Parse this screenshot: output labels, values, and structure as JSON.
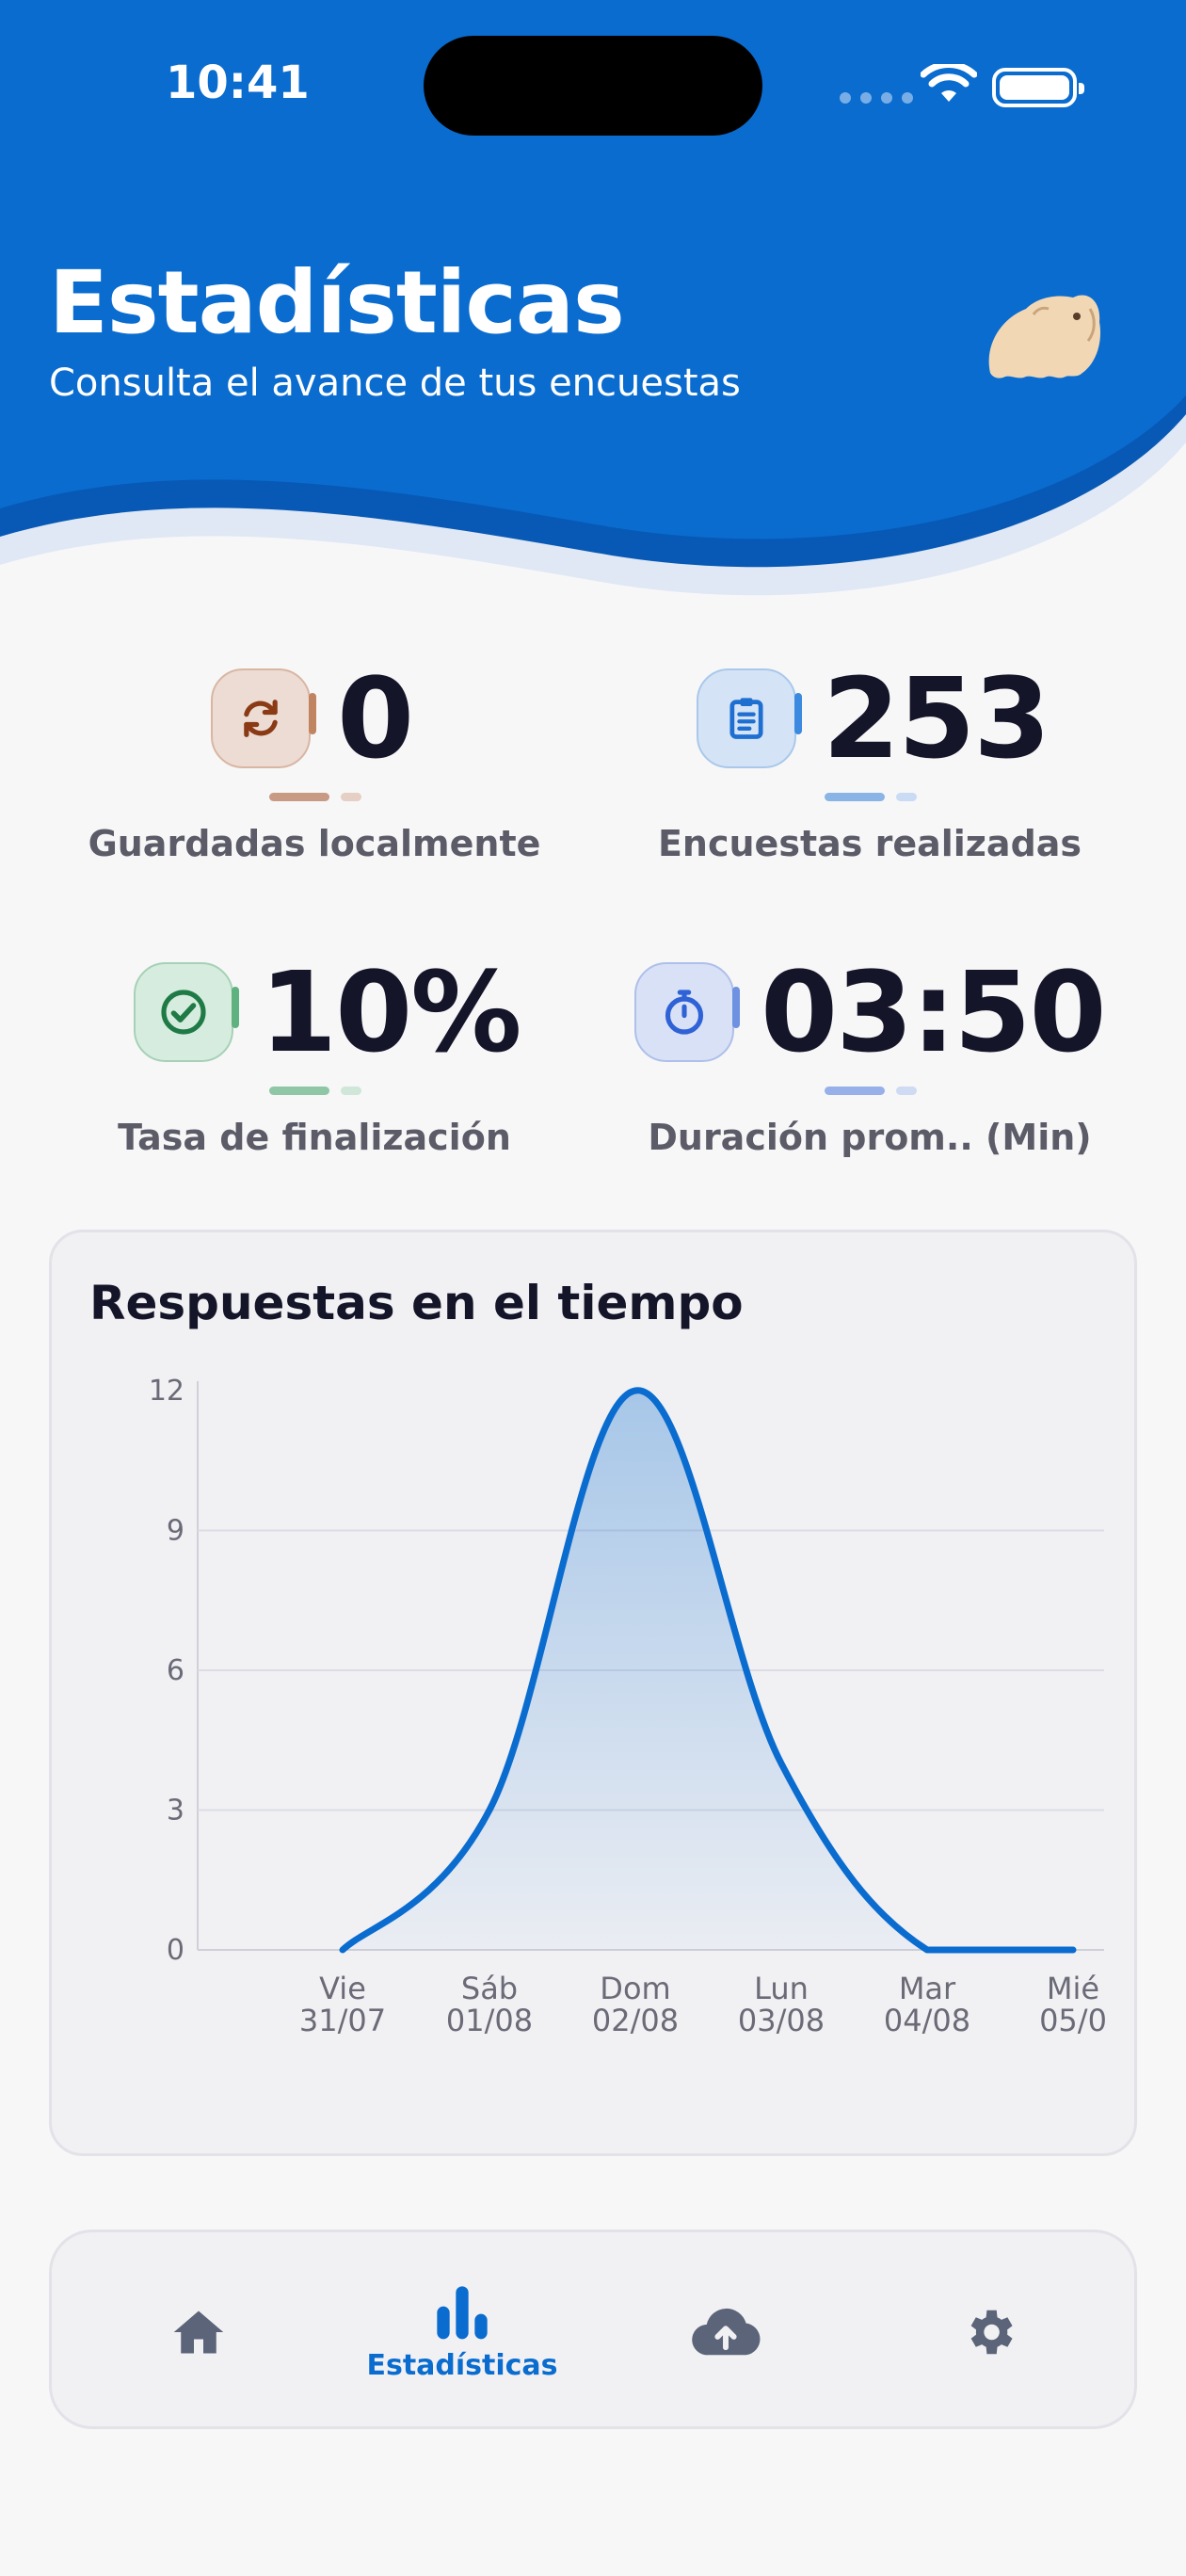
{
  "status_bar": {
    "time": "10:41"
  },
  "header": {
    "title": "Estadísticas",
    "subtitle": "Consulta el avance de tus encuestas",
    "color": "#0a6ccf"
  },
  "stats": [
    {
      "value": "0",
      "label": "Guardadas localmente",
      "icon": "sync-icon",
      "color": "#8a3a14"
    },
    {
      "value": "253",
      "label": "Encuestas realizadas",
      "icon": "clipboard-icon",
      "color": "#1f6fd1"
    },
    {
      "value": "10%",
      "label": "Tasa de finalización",
      "icon": "check-circle-icon",
      "color": "#1f7a45"
    },
    {
      "value": "03:50",
      "label": "Duración prom..  (Min)",
      "icon": "stopwatch-icon",
      "color": "#2f62d6"
    }
  ],
  "chart_data": {
    "type": "area",
    "title": "Respuestas en el tiempo",
    "categories": [
      "Vie 31/07",
      "Sáb 01/08",
      "Dom 02/08",
      "Lun 03/08",
      "Mar 04/08",
      "Mié 05/0"
    ],
    "x_ticks": [
      {
        "line1": "Vie",
        "line2": "31/07"
      },
      {
        "line1": "Sáb",
        "line2": "01/08"
      },
      {
        "line1": "Dom",
        "line2": "02/08"
      },
      {
        "line1": "Lun",
        "line2": "03/08"
      },
      {
        "line1": "Mar",
        "line2": "04/08"
      },
      {
        "line1": "Mié",
        "line2": "05/0"
      }
    ],
    "series": [
      {
        "values": [
          0,
          3,
          12,
          4,
          0,
          0
        ]
      }
    ],
    "y_ticks": [
      "0",
      "3",
      "6",
      "9",
      "12"
    ],
    "ylim": [
      0,
      12
    ],
    "grid": true,
    "line_color": "#0a6ccf"
  },
  "bottom_nav": {
    "items": [
      {
        "name": "nav-home",
        "icon": "home-icon",
        "label": ""
      },
      {
        "name": "nav-statistics",
        "icon": "bar-chart-icon",
        "label": "Estadísticas",
        "active": true
      },
      {
        "name": "nav-upload",
        "icon": "cloud-upload-icon",
        "label": ""
      },
      {
        "name": "nav-settings",
        "icon": "gear-icon",
        "label": ""
      }
    ],
    "active_color": "#0a6ccf",
    "inactive_color": "#5b6478"
  }
}
